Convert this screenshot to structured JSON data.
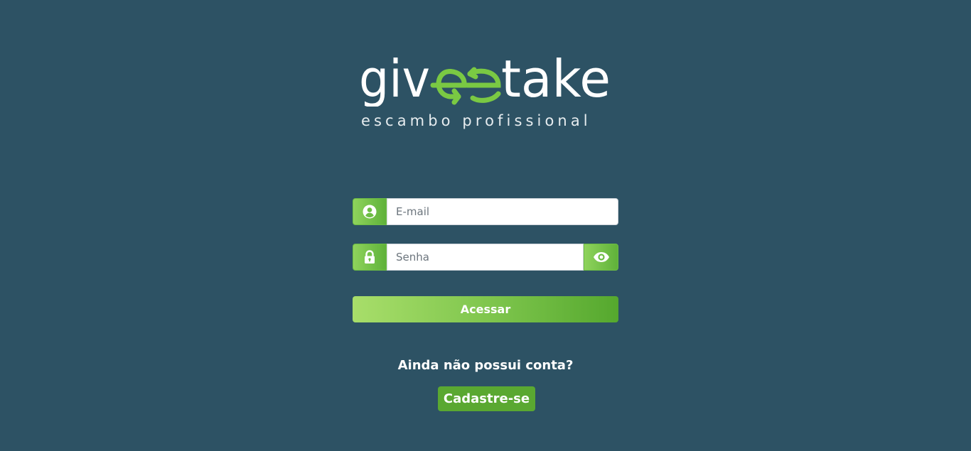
{
  "brand": {
    "name_part1": "giv",
    "name_part2": "take",
    "tagline": "escambo profissional",
    "colors": {
      "background": "#2d5264",
      "accent_green": "#6dbd44",
      "logo_white": "#ffffff"
    }
  },
  "login_form": {
    "email": {
      "placeholder": "E-mail",
      "value": "",
      "icon": "user-circle-icon"
    },
    "password": {
      "placeholder": "Senha",
      "value": "",
      "icon": "lock-icon",
      "toggle_icon": "eye-icon"
    },
    "submit_label": "Acessar"
  },
  "signup": {
    "question": "Ainda não possui conta?",
    "button_label": "Cadastre-se"
  }
}
